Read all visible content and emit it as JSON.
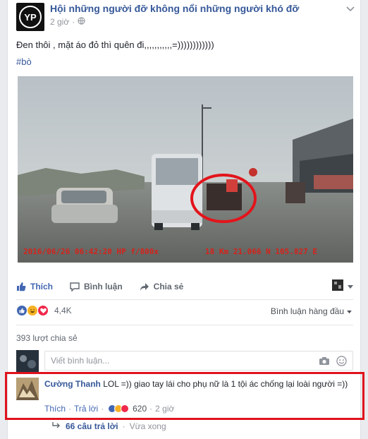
{
  "header": {
    "group_name": "Hội những người đỡ không nổi những người khó đỡ",
    "time": "2 giờ",
    "audience_icon": "globe-icon"
  },
  "post": {
    "text": "Đen thôi , mặt áo đỏ thì quên đi,,,,,,,,,,,=))))))))))))",
    "hashtag": "#bò",
    "video_overlay": {
      "left": "2016/06/26 06:42:20 HP f/800x",
      "right": "18 Km 21.066 N 105.827 E"
    }
  },
  "actions": {
    "like": "Thích",
    "comment": "Bình luận",
    "share": "Chia sẻ"
  },
  "reactions": {
    "count": "4,4K",
    "sort_label": "Bình luận hàng đầu",
    "colors": {
      "like": "#4267b2",
      "haha": "#f7b125",
      "love": "#f0284a"
    }
  },
  "shares": {
    "label": "393 lượt chia sẻ"
  },
  "composer": {
    "placeholder": "Viết bình luận..."
  },
  "comment": {
    "author": "Cường Thanh",
    "text": "LOL =)) giao tay lái cho phụ nữ là 1 tội ác chống lại loài người =))",
    "like": "Thích",
    "reply": "Trả lời",
    "reaction_count": "620",
    "time": "2 giờ",
    "highlight_color": "#e0121d"
  },
  "replies": {
    "label": "66 câu trả lời",
    "sep": "·",
    "time": "Vừa xong"
  }
}
